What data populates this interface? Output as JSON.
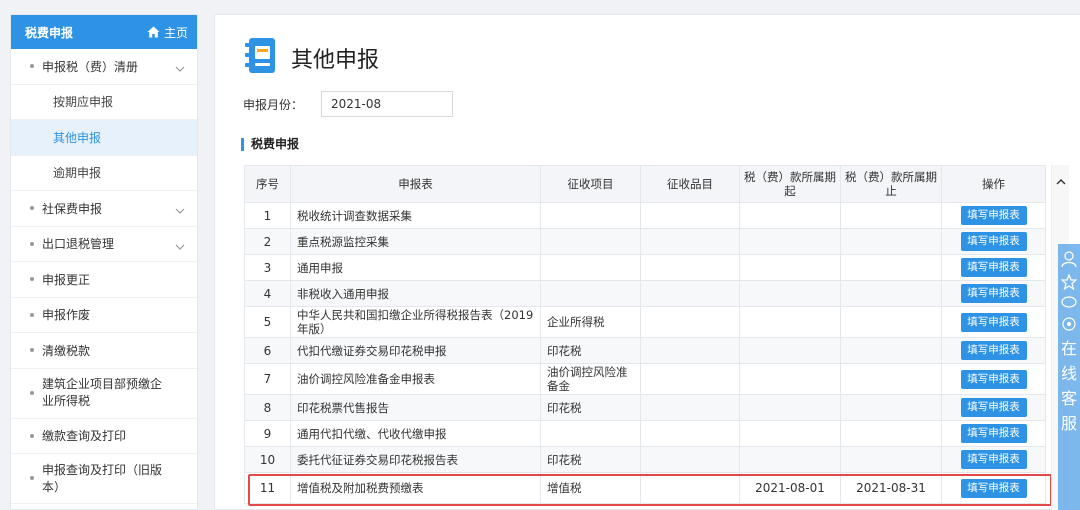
{
  "sidebar": {
    "header": "税费申报",
    "home_label": "主页",
    "items": [
      {
        "label": "申报税（费）清册"
      },
      {
        "label": "按期应申报"
      },
      {
        "label": "其他申报"
      },
      {
        "label": "逾期申报"
      },
      {
        "label": "社保费申报"
      },
      {
        "label": "出口退税管理"
      },
      {
        "label": "申报更正"
      },
      {
        "label": "申报作废"
      },
      {
        "label": "清缴税款"
      },
      {
        "label": "建筑企业项目部预缴企业所得税"
      },
      {
        "label": "缴款查询及打印"
      },
      {
        "label": "申报查询及打印（旧版本）"
      }
    ]
  },
  "page": {
    "title": "其他申报",
    "month_label": "申报月份：",
    "month_value": "2021-08",
    "section_title": "税费申报"
  },
  "table": {
    "headers": [
      "序号",
      "申报表",
      "征收项目",
      "征收品目",
      "税（费）款所属期起",
      "税（费）款所属期止",
      "操作"
    ],
    "button_label": "填写申报表",
    "rows": [
      {
        "no": "1",
        "form": "税收统计调查数据采集",
        "item": "",
        "subitem": "",
        "start": "",
        "end": ""
      },
      {
        "no": "2",
        "form": "重点税源监控采集",
        "item": "",
        "subitem": "",
        "start": "",
        "end": ""
      },
      {
        "no": "3",
        "form": "通用申报",
        "item": "",
        "subitem": "",
        "start": "",
        "end": ""
      },
      {
        "no": "4",
        "form": "非税收入通用申报",
        "item": "",
        "subitem": "",
        "start": "",
        "end": ""
      },
      {
        "no": "5",
        "form": "中华人民共和国扣缴企业所得税报告表（2019年版）",
        "item": "企业所得税",
        "subitem": "",
        "start": "",
        "end": ""
      },
      {
        "no": "6",
        "form": "代扣代缴证券交易印花税申报",
        "item": "印花税",
        "subitem": "",
        "start": "",
        "end": ""
      },
      {
        "no": "7",
        "form": "油价调控风险准备金申报表",
        "item": "油价调控风险准备金",
        "subitem": "",
        "start": "",
        "end": ""
      },
      {
        "no": "8",
        "form": "印花税票代售报告",
        "item": "印花税",
        "subitem": "",
        "start": "",
        "end": ""
      },
      {
        "no": "9",
        "form": "通用代扣代缴、代收代缴申报",
        "item": "",
        "subitem": "",
        "start": "",
        "end": ""
      },
      {
        "no": "10",
        "form": "委托代征证券交易印花税报告表",
        "item": "印花税",
        "subitem": "",
        "start": "",
        "end": ""
      },
      {
        "no": "11",
        "form": "增值税及附加税费预缴表",
        "item": "增值税",
        "subitem": "",
        "start": "2021-08-01",
        "end": "2021-08-31"
      }
    ]
  },
  "float_bar": {
    "text": [
      "在",
      "线",
      "客",
      "服"
    ]
  },
  "colors": {
    "accent": "#2e93e4",
    "highlight": "#e24a4a"
  }
}
